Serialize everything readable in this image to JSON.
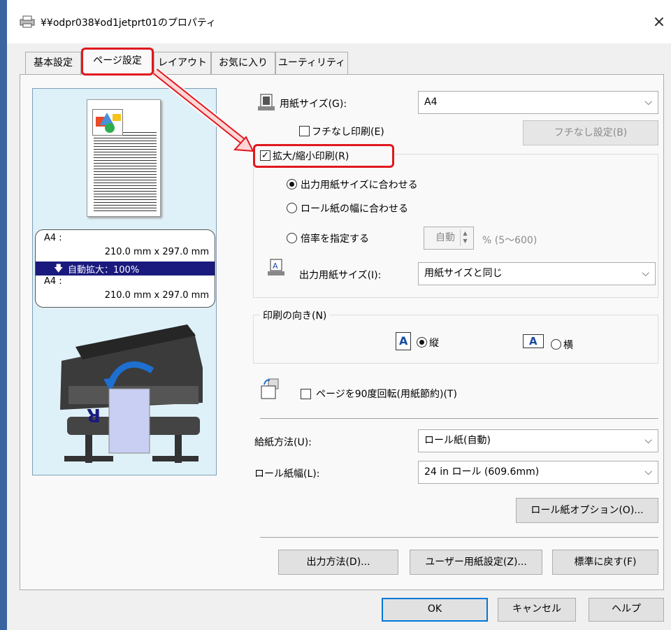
{
  "window": {
    "title": "¥¥odpr038¥od1jetprt01のプロパティ",
    "close_glyph": "×"
  },
  "tabs": [
    {
      "label": "基本設定"
    },
    {
      "label": "ページ設定"
    },
    {
      "label": "レイアウト"
    },
    {
      "label": "お気に入り"
    },
    {
      "label": "ユーティリティ"
    }
  ],
  "preview": {
    "input_size": "A4 :",
    "input_dims": "210.0 mm x 297.0 mm",
    "scale": "自動拡大：100%",
    "output_size": "A4 :",
    "output_dims": "210.0 mm x 297.0 mm",
    "scale_arrow": "🡇",
    "printer_letter": "R"
  },
  "page_size": {
    "label": "用紙サイズ(G):",
    "value": "A4"
  },
  "borderless": {
    "label": "フチなし印刷(E)",
    "button": "フチなし設定(B)"
  },
  "scaled_print": {
    "label": "拡大/縮小印刷(R)",
    "checked_glyph": "✓"
  },
  "scale_options": [
    {
      "label": "出力用紙サイズに合わせる",
      "selected": true
    },
    {
      "label": "ロール紙の幅に合わせる",
      "selected": false
    },
    {
      "label": "倍率を指定する",
      "selected": false
    }
  ],
  "ratio": {
    "value": "自動",
    "range": "%  (5〜600)"
  },
  "output_size": {
    "label": "出力用紙サイズ(I):",
    "value": "用紙サイズと同じ"
  },
  "orientation": {
    "label": "印刷の向き(N)",
    "portrait": "縦",
    "landscape": "横",
    "icon_letter": "A"
  },
  "rotate": {
    "label": "ページを90度回転(用紙節約)(T)"
  },
  "paper_source": {
    "label": "給紙方法(U):",
    "value": "ロール紙(自動)"
  },
  "roll_width": {
    "label": "ロール紙幅(L):",
    "value": "24 in ロール (609.6mm)"
  },
  "buttons": {
    "roll_options": "ロール紙オプション(O)...",
    "output_method": "出力方法(D)...",
    "user_paper": "ユーザー用紙設定(Z)...",
    "restore": "標準に戻す(F)",
    "ok": "OK",
    "cancel": "キャンセル",
    "help": "ヘルプ"
  },
  "colors": {
    "highlight": "#e0181f",
    "accent": "#0078d7",
    "band": "#1a1a7e",
    "preview_bg": "#dff1f8"
  },
  "icons": [
    "printer-icon",
    "chevron-down-icon",
    "spin-up-down-icon",
    "portrait-icon",
    "landscape-icon",
    "rotate-page-icon",
    "page-size-icon",
    "output-size-icon",
    "annotation-arrow"
  ]
}
